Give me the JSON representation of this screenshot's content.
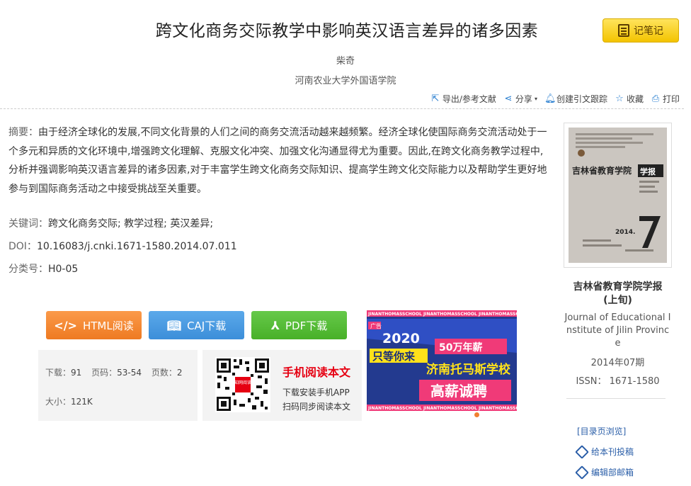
{
  "article": {
    "title": "跨文化商务交际教学中影响英汉语言差异的诸多因素",
    "author": "柴奇",
    "affiliation": "河南农业大学外国语学院",
    "abstract_label": "摘要：",
    "abstract": "由于经济全球化的发展,不同文化背景的人们之间的商务交流活动越来越频繁。经济全球化使国际商务交流活动处于一个多元和异质的文化环境中,增强跨文化理解、克服文化冲突、加强文化沟通显得尤为重要。因此,在跨文化商务教学过程中,分析并强调影响英汉语言差异的诸多因素,对于丰富学生跨文化商务交际知识、提高学生跨文化交际能力以及帮助学生更好地参与到国际商务活动之中接受挑战至关重要。",
    "keywords_label": "关键词：",
    "keywords": "跨文化商务交际; 教学过程; 英汉差异;",
    "doi_label": "DOI：",
    "doi": "10.16083/j.cnki.1671-1580.2014.07.011",
    "class_label": "分类号：",
    "class_no": "H0-05"
  },
  "note_button": "记笔记",
  "toolbar": {
    "export": "导出/参考文献",
    "share": "分享",
    "track": "创建引文跟踪",
    "favorite": "收藏",
    "print": "打印"
  },
  "downloads": {
    "html": "HTML阅读",
    "caj": "CAJ下载",
    "pdf": "PDF下载"
  },
  "stats": {
    "downloads_label": "下载：",
    "downloads": "91",
    "pages_label": "页码：",
    "pages": "53-54",
    "page_count_label": "页数：",
    "page_count": "2",
    "size_label": "大小：",
    "size": "121K"
  },
  "mobile": {
    "title": "手机阅读本文",
    "line1": "下载安装手机APP",
    "line2": "扫码同步阅读本文",
    "qr_label": "知网阅读"
  },
  "ad": {
    "tag": "广告",
    "year": "2020",
    "line1": "只等你来",
    "salary": "50万年薪",
    "school": "济南托马斯学校",
    "hiring": "高薪诚聘",
    "ribbon": "JINANTHOMASSCHOOL"
  },
  "journal": {
    "name_line1": "吉林省教育学院学报",
    "name_line2": "(上旬)",
    "english": "Journal of Educational Institute of Jilin Province",
    "date": "2014年07期",
    "issn": "ISSN：  1671-1580",
    "cover_title": "吉林省教育学院",
    "cover_badge": "学报",
    "cover_year": "2014."
  },
  "side_links": {
    "catalog": "[目录页浏览]",
    "submit": "给本刊投稿",
    "editorial": "编辑部邮箱"
  }
}
